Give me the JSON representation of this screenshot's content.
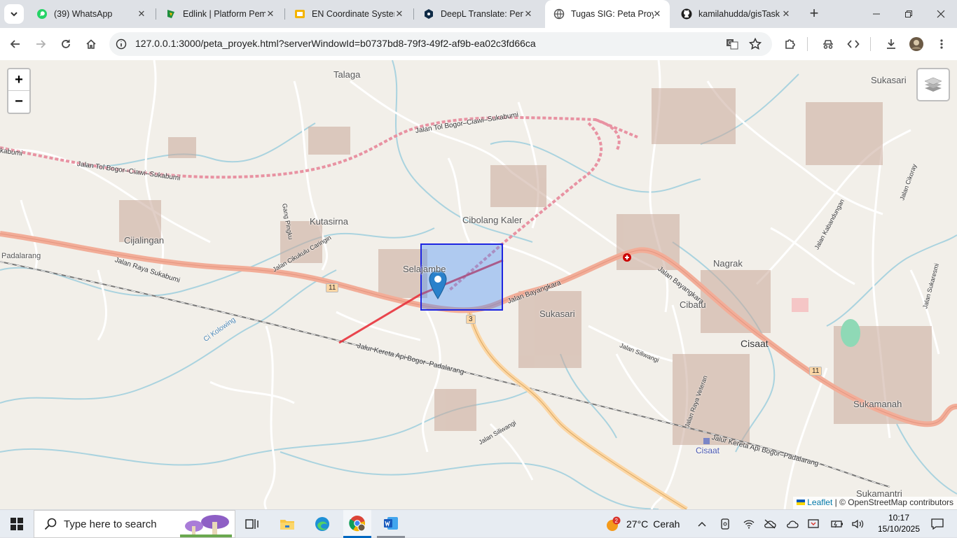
{
  "browser": {
    "tabs": [
      {
        "title": "(39) WhatsApp",
        "icon": "whatsapp-icon",
        "active": false
      },
      {
        "title": "Edlink | Platform Pem",
        "icon": "edlink-icon",
        "active": false
      },
      {
        "title": "EN Coordinate Systen",
        "icon": "slides-icon",
        "active": false
      },
      {
        "title": "DeepL Translate: Pen",
        "icon": "deepl-icon",
        "active": false
      },
      {
        "title": "Tugas SIG: Peta Proye",
        "icon": "globe-icon",
        "active": true
      },
      {
        "title": "kamilahudda/gisTask",
        "icon": "github-icon",
        "active": false
      }
    ],
    "url": "127.0.0.1:3000/peta_proyek.html?serverWindowId=b0737bd8-79f3-49f2-af9b-ea02c3fd66ca"
  },
  "map": {
    "zoom_in": "+",
    "zoom_out": "−",
    "labels": {
      "talaga": "Talaga",
      "sukasari_ne": "Sukasari",
      "kutasirna": "Kutasirna",
      "cibolang_kaler": "Cibolang Kaler",
      "cijalingan": "Cijalingan",
      "selajambe": "Selajambe",
      "nagrak": "Nagrak",
      "cibatu": "Cibatu",
      "sukasari": "Sukasari",
      "cisaat": "Cisaat",
      "sukamanah": "Sukamanah",
      "sukamantri": "Sukamantri",
      "padalarang": "Padalarang",
      "cisaat_station": "Cisaat"
    },
    "road_labels": {
      "tol1": "Jalan Tol Bogor–Ciawi–Sukabumi",
      "tol2": "Jalan Tol Bogor–Ciawi–Sukabumi",
      "tol3": "kabumi",
      "raya": "Jalan Raya Sukabumi",
      "bayangkara1": "Jalan Bayangkara",
      "bayangkara2": "Jalan Bayangkara",
      "rail1": "Jalur Kereta Api Bogor–Padalarang",
      "rail2": "Jalur Kereta Api Bogor–Padalarang",
      "siliwangi1": "Jalan Siliwangi",
      "siliwangi2": "Jalan Siliwangi",
      "cikukulu": "Jalan Cikukulu Caringin",
      "kabandungan": "Jalan Kabandungan",
      "raya_veteran": "Jalan Raya Veteran",
      "cikoray": "Jalan Cikoray",
      "sukaresmi": "Jalan Sukaresmi",
      "gang": "Gang Pingku",
      "kolowing": "Ci Kolowing"
    },
    "shields": [
      "11",
      "11",
      "3"
    ],
    "attribution": {
      "leaflet": "Leaflet",
      "rest": "| © OpenStreetMap contributors"
    }
  },
  "taskbar": {
    "search_placeholder": "Type here to search",
    "weather_temp": "27°C",
    "weather_text": "Cerah",
    "weather_badge": "2",
    "time": "10:17",
    "date": "15/10/2025"
  }
}
